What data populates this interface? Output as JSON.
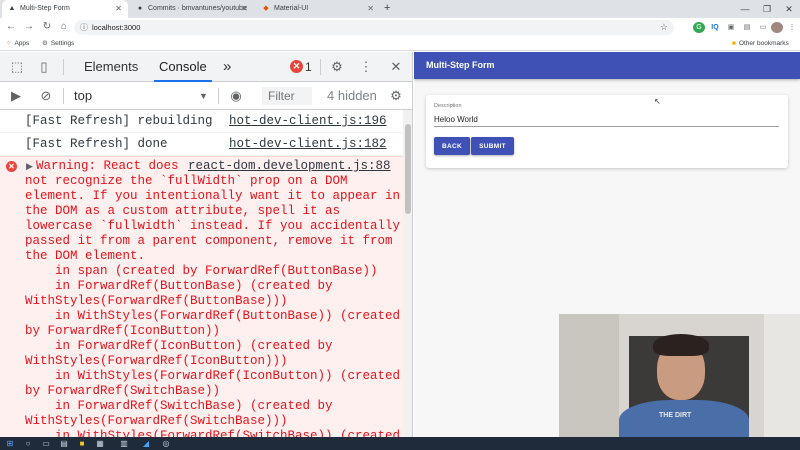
{
  "browser": {
    "tabs": [
      {
        "title": "Multi-Step Form",
        "icon": "app-icon",
        "active": true
      },
      {
        "title": "Commits · bmvantunes/youtube",
        "icon": "github-icon",
        "active": false
      },
      {
        "title": "Material-UI",
        "icon": "mui-icon",
        "active": false
      }
    ],
    "new_tab": "+",
    "url": "localhost:3000",
    "bookmarks": {
      "apps": "Apps",
      "settings": "Settings",
      "other": "Other bookmarks"
    }
  },
  "devtools": {
    "tabs": {
      "elements": "Elements",
      "console": "Console",
      "more": "»"
    },
    "error_count": "1",
    "context": "top",
    "filter_placeholder": "Filter",
    "hidden": "4 hidden",
    "logs": [
      {
        "message": "[Fast Refresh] rebuilding",
        "source": "hot-dev-client.js:196"
      },
      {
        "message": "[Fast Refresh] done",
        "source": "hot-dev-client.js:182"
      }
    ],
    "error": {
      "source": "react-dom.development.js:88",
      "lines": [
        "Warning: React does",
        "not recognize the `fullWidth` prop on a DOM",
        "element. If you intentionally want it to appear in",
        "the DOM as a custom attribute, spell it as",
        "lowercase `fullwidth` instead. If you accidentally",
        "passed it from a parent component, remove it from",
        "the DOM element.",
        "    in span (created by ForwardRef(ButtonBase))",
        "    in ForwardRef(ButtonBase) (created by",
        "WithStyles(ForwardRef(ButtonBase)))",
        "    in WithStyles(ForwardRef(ButtonBase)) (created",
        "by ForwardRef(IconButton))",
        "    in ForwardRef(IconButton) (created by",
        "WithStyles(ForwardRef(IconButton)))",
        "    in WithStyles(ForwardRef(IconButton)) (created",
        "by ForwardRef(SwitchBase))",
        "    in ForwardRef(SwitchBase) (created by",
        "WithStyles(ForwardRef(SwitchBase)))",
        "    in WithStyles(ForwardRef(SwitchBase)) (created"
      ]
    }
  },
  "app": {
    "title": "Multi-Step Form",
    "field_label": "Description",
    "field_value": "Heloo World",
    "back_label": "BACK",
    "submit_label": "SUBMIT",
    "webcam_shirt": "THE DIRT"
  },
  "colors": {
    "appbar": "#3f51b5",
    "error_text": "#e3141b",
    "error_bg": "#fff0f0"
  }
}
